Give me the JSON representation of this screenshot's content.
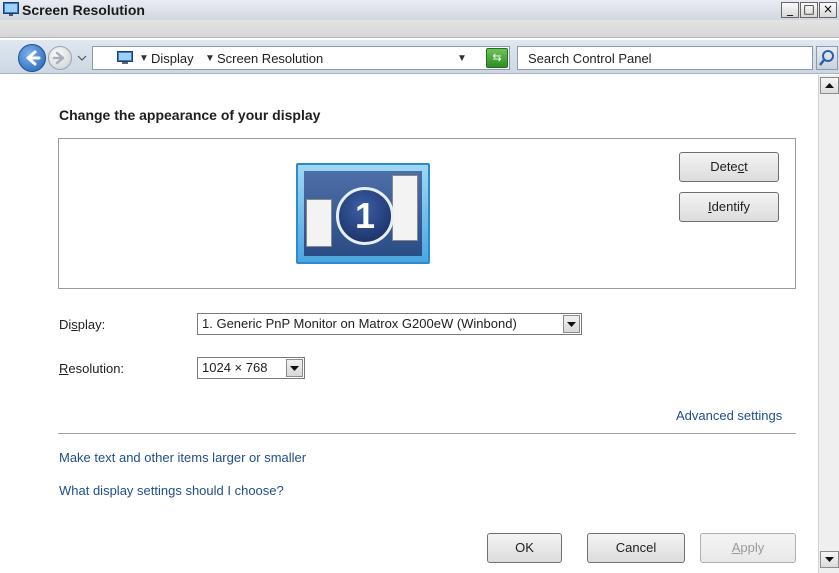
{
  "window": {
    "title": "Screen Resolution",
    "min": "_",
    "max": "□",
    "close": "×"
  },
  "nav": {
    "breadcrumbs": [
      "Display",
      "Screen Resolution"
    ],
    "search_placeholder": "Search Control Panel"
  },
  "main": {
    "heading": "Change the appearance of your display",
    "monitor_number": "1",
    "detect_label_pre": "Dete",
    "detect_label_ul": "c",
    "detect_label_post": "t",
    "identify_label_ul": "I",
    "identify_label_post": "dentify",
    "display_label_pre": "Di",
    "display_label_ul": "s",
    "display_label_post": "play:",
    "display_value": "1. Generic PnP Monitor on Matrox G200eW (Winbond)",
    "resolution_label_ul": "R",
    "resolution_label_post": "esolution:",
    "resolution_value": "1024 × 768",
    "advanced_link": "Advanced settings",
    "link_text_size": "Make text and other items larger or smaller",
    "link_help": "What display settings should I choose?"
  },
  "footer": {
    "ok": "OK",
    "cancel": "Cancel",
    "apply_ul": "A",
    "apply_post": "pply"
  },
  "colors": {
    "link": "#1f4e8c",
    "monitor_badge": "#14285c",
    "accent_blue": "#2d8ad0"
  }
}
